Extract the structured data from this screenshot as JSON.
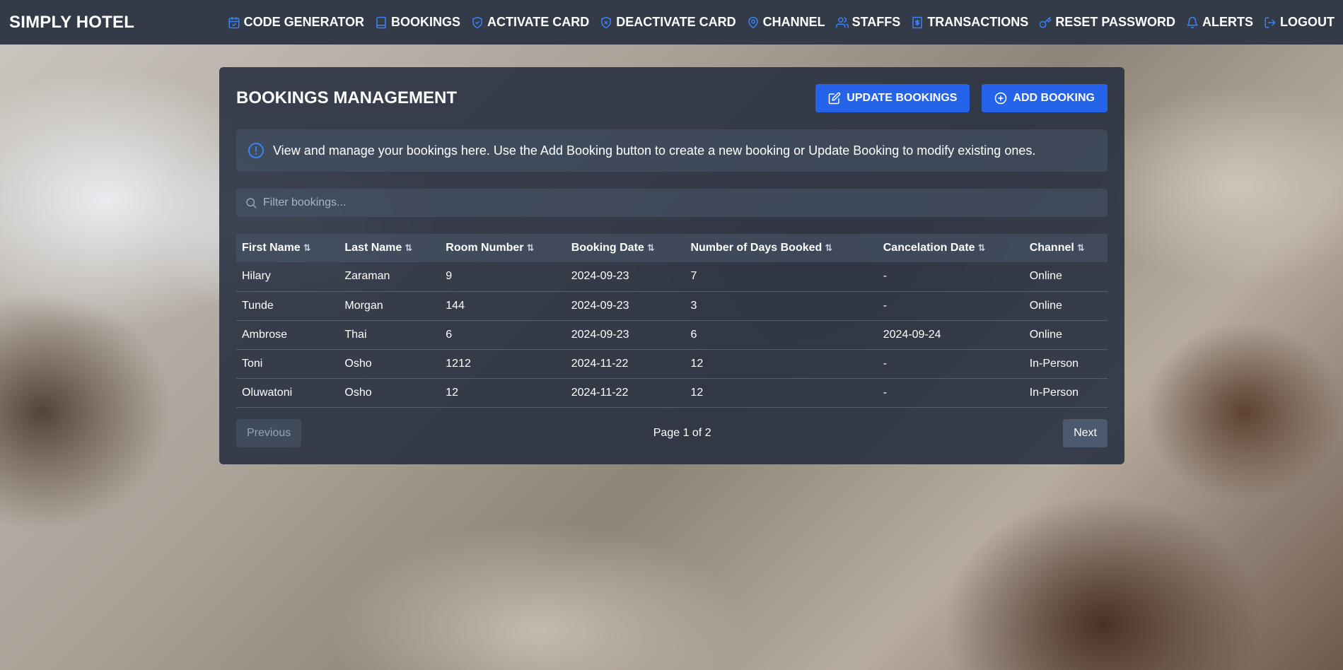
{
  "app": {
    "brand": "SIMPLY HOTEL"
  },
  "nav": [
    {
      "label": "CODE GENERATOR",
      "icon": "calendar-check-icon"
    },
    {
      "label": "BOOKINGS",
      "icon": "book-icon"
    },
    {
      "label": "ACTIVATE CARD",
      "icon": "shield-check-icon"
    },
    {
      "label": "DEACTIVATE CARD",
      "icon": "shield-x-icon"
    },
    {
      "label": "CHANNEL",
      "icon": "map-pin-icon"
    },
    {
      "label": "STAFFS",
      "icon": "users-icon"
    },
    {
      "label": "TRANSACTIONS",
      "icon": "receipt-icon"
    },
    {
      "label": "RESET PASSWORD",
      "icon": "key-icon"
    },
    {
      "label": "ALERTS",
      "icon": "bell-icon"
    },
    {
      "label": "LOGOUT",
      "icon": "logout-icon"
    }
  ],
  "panel": {
    "title": "BOOKINGS MANAGEMENT",
    "update_label": "UPDATE BOOKINGS",
    "add_label": "ADD BOOKING",
    "info": "View and manage your bookings here. Use the Add Booking button to create a new booking or Update Booking to modify existing ones.",
    "filter_placeholder": "Filter bookings..."
  },
  "table": {
    "columns": [
      "First Name",
      "Last Name",
      "Room Number",
      "Booking Date",
      "Number of Days Booked",
      "Cancelation Date",
      "Channel"
    ],
    "rows": [
      [
        "Hilary",
        "Zaraman",
        "9",
        "2024-09-23",
        "7",
        "-",
        "Online"
      ],
      [
        "Tunde",
        "Morgan",
        "144",
        "2024-09-23",
        "3",
        "-",
        "Online"
      ],
      [
        "Ambrose",
        "Thai",
        "6",
        "2024-09-23",
        "6",
        "2024-09-24",
        "Online"
      ],
      [
        "Toni",
        "Osho",
        "1212",
        "2024-11-22",
        "12",
        "-",
        "In-Person"
      ],
      [
        "Oluwatoni",
        "Osho",
        "12",
        "2024-11-22",
        "12",
        "-",
        "In-Person"
      ]
    ]
  },
  "pagination": {
    "previous": "Previous",
    "page_info": "Page 1 of 2",
    "next": "Next"
  },
  "colors": {
    "accent": "#2563eb",
    "topbar": "#333b48",
    "panel": "#252e3e"
  }
}
